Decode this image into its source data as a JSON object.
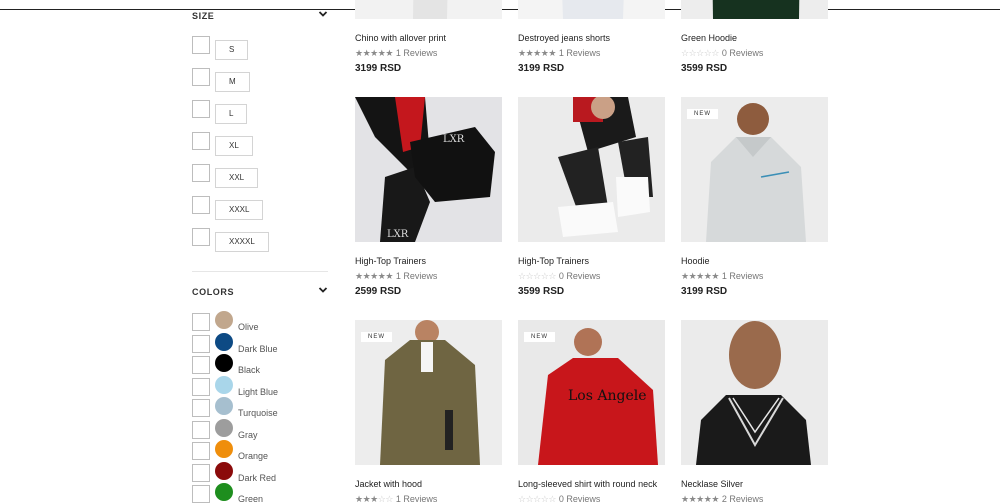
{
  "sidebar": {
    "size_title": "SIZE",
    "sizes": [
      "S",
      "M",
      "L",
      "XL",
      "XXL",
      "XXXL",
      "XXXXL"
    ],
    "colors_title": "COLORS",
    "colors": [
      {
        "label": "Olive",
        "hex": "#c1a78d"
      },
      {
        "label": "Dark Blue",
        "hex": "#0d4a84"
      },
      {
        "label": "Black",
        "hex": "#000000"
      },
      {
        "label": "Light Blue",
        "hex": "#a9d6ea"
      },
      {
        "label": "Turquoise",
        "hex": "#a6bfcf"
      },
      {
        "label": "Gray",
        "hex": "#9d9d9d"
      },
      {
        "label": "Orange",
        "hex": "#ef8e0c"
      },
      {
        "label": "Dark Red",
        "hex": "#8b0b0b"
      },
      {
        "label": "Green",
        "hex": "#1e8e1e"
      }
    ]
  },
  "products": [
    {
      "name": "Chino with allover print",
      "stars": 5,
      "reviews": "1 Reviews",
      "price": "3199 RSD",
      "badge": ""
    },
    {
      "name": "Destroyed jeans shorts",
      "stars": 5,
      "reviews": "1 Reviews",
      "price": "3199 RSD",
      "badge": ""
    },
    {
      "name": "Green Hoodie",
      "stars": 0,
      "reviews": "0 Reviews",
      "price": "3599 RSD",
      "badge": ""
    },
    {
      "name": "High-Top Trainers",
      "stars": 5,
      "reviews": "1 Reviews",
      "price": "2599 RSD",
      "badge": ""
    },
    {
      "name": "High-Top Trainers",
      "stars": 0,
      "reviews": "0 Reviews",
      "price": "3599 RSD",
      "badge": ""
    },
    {
      "name": "Hoodie",
      "stars": 5,
      "reviews": "1 Reviews",
      "price": "3199 RSD",
      "badge": "NEW"
    },
    {
      "name": "Jacket with hood",
      "stars": 3,
      "reviews": "1 Reviews",
      "price": "",
      "badge": "NEW"
    },
    {
      "name": "Long-sleeved shirt with round neck",
      "stars": 0,
      "reviews": "0 Reviews",
      "price": "",
      "badge": "NEW"
    },
    {
      "name": "Necklase Silver",
      "stars": 5,
      "reviews": "2 Reviews",
      "price": "",
      "badge": ""
    }
  ]
}
